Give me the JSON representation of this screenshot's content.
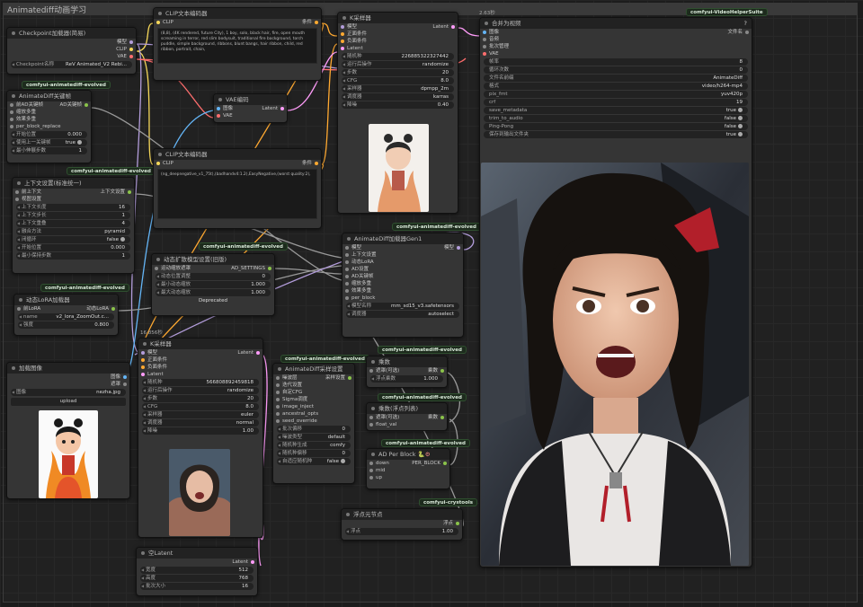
{
  "title": "Animatediff动画学习",
  "colors": {
    "clip": "#f6d85a",
    "model": "#b39ddb",
    "vae": "#ff6e6e",
    "cond": "#ffa931",
    "latent": "#ff9cf9",
    "image": "#64b5f6",
    "gen": "#8bc34a"
  },
  "badges": {
    "evolved": "comfyui-animatediff-evolved",
    "vhs": "comfyui-VideoHelperSuite",
    "crys": "comfyui-crystools"
  },
  "ckpt": {
    "title": "Checkpoint加载器(简易)",
    "o_model": "模型",
    "o_clip": "CLIP",
    "o_vae": "VAE",
    "w_label": "Checkpoint名称",
    "w_val": "ReV Animated_V2 Rebi..."
  },
  "clip1": {
    "title": "CLIP文本编码器",
    "i_clip": "CLIP",
    "o_cond": "条件",
    "text": "(8,8), (4K rendered, future City), 1 boy, solo, black hair, fire, open mouth screaming in terror, red slim bodysuit, traditional fire background, torch puddle, simple background, ribbons, blunt bangs, hair ribbon, child, red ribbon, portrait, chain,"
  },
  "clip2": {
    "title": "CLIP文本编码器",
    "i_clip": "CLIP",
    "o_cond": "条件",
    "text": "(ng_deepnegative_v1_75t),(badhandv4:1.2),EasyNegative,(worst quality:2),"
  },
  "vaeenc": {
    "title": "VAE编码",
    "i_img": "图像",
    "i_vae": "VAE",
    "o_lat": "Latent"
  },
  "ksampler1": {
    "title": "K采样器",
    "i_model": "模型",
    "i_pos": "正面条件",
    "i_neg": "负面条件",
    "i_lat": "Latent",
    "o_lat": "Latent",
    "rows": [
      [
        "随机种",
        "226885322327442"
      ],
      [
        "运行后操作",
        "randomize"
      ],
      [
        "步数",
        "20"
      ],
      [
        "CFG",
        "8.0"
      ],
      [
        "采样器",
        "dpmpp_2m"
      ],
      [
        "调度器",
        "karras"
      ],
      [
        "降噪",
        "0.40"
      ]
    ]
  },
  "ksampler2": {
    "label": "16.856秒",
    "title": "K采样器",
    "i_model": "模型",
    "i_pos": "正面条件",
    "i_neg": "负面条件",
    "i_lat": "Latent",
    "o_lat": "Latent",
    "rows": [
      [
        "随机种",
        "566808892459818"
      ],
      [
        "运行后操作",
        "randomize"
      ],
      [
        "步数",
        "20"
      ],
      [
        "CFG",
        "8.0"
      ],
      [
        "采样器",
        "euler"
      ],
      [
        "调度器",
        "normal"
      ],
      [
        "降噪",
        "1.00"
      ]
    ]
  },
  "adkeyframe": {
    "title": "AnimateDiff关键帧",
    "i_prev": "前AD关键帧",
    "o_kf": "AD关键帧",
    "i1": "缩放多重",
    "i2": "效果多重",
    "i3": "per_block_replace",
    "rows": [
      [
        "开始位置",
        "0.000"
      ],
      [
        "使用上一关键帧",
        "true"
      ],
      [
        "最小伸展步数",
        "1"
      ]
    ]
  },
  "context": {
    "title": "上下文设置(标准统一)",
    "i_prev": "前上下文",
    "o_ctx": "上下文设置",
    "i_view": "视图设置",
    "rows": [
      [
        "上下文长度",
        "16"
      ],
      [
        "上下文步长",
        "1"
      ],
      [
        "上下文重叠",
        "4"
      ],
      [
        "融合方法",
        "pyramid"
      ],
      [
        "闭循环",
        "false"
      ],
      [
        "开始位置",
        "0.000"
      ],
      [
        "最小保持步数",
        "1"
      ]
    ]
  },
  "lora": {
    "title": "动态LoRA加载器",
    "i_prev": "前LoRA",
    "o_lora": "动态LoRA",
    "w1": "name",
    "w1v": "v2_lora_ZoomOut.c...",
    "w2": "强度",
    "w2v": "0.800"
  },
  "loadimg": {
    "title": "加载图像",
    "o_img": "图像",
    "o_mask": "遮罩",
    "w_label": "图像",
    "w_val": "nezha.jpg",
    "upload": "upload"
  },
  "motion": {
    "title": "动态扩散模型设置(旧版)",
    "i1": "运动缩放遮罩",
    "o": "AD_SETTINGS",
    "rows": [
      [
        "动态位置调整",
        "0"
      ],
      [
        "最小动态缩放",
        "1.000"
      ],
      [
        "最大动态缩放",
        "1.000"
      ]
    ],
    "status": "Deprecated"
  },
  "adloader": {
    "title": "AnimateDiff加载器Gen1",
    "i": [
      "模型",
      "上下文设置",
      "动态LoRA",
      "AD设置",
      "AD关键帧",
      "缩放多重",
      "效果多重",
      "per_block"
    ],
    "o": "模型",
    "rows": [
      [
        "模型名称",
        "mm_sd15_v3.safetensors"
      ],
      [
        "调度器",
        "autoselect"
      ]
    ]
  },
  "adsampling": {
    "title": "AnimateDiff采样设置",
    "o": "采样设置",
    "i": [
      "噪波层",
      "迭代设置",
      "自定CFG",
      "Sigma调度",
      "image_inject",
      "ancestral_opts",
      "seed_override"
    ],
    "rows": [
      [
        "批次偏移",
        "0"
      ],
      [
        "噪波类型",
        "default"
      ],
      [
        "随机种生成",
        "comfy"
      ],
      [
        "随机种偏移",
        "0"
      ],
      [
        "自适应随机种",
        "false"
      ]
    ]
  },
  "mult1": {
    "title": "乘数",
    "i": "遮罩(可选)",
    "o": "乘数",
    "w": "浮点乘数",
    "wv": "1.000"
  },
  "mult2": {
    "title": "乘数(浮点列表)",
    "i1": "遮罩(可选)",
    "i2": "float_val",
    "o": "乘数"
  },
  "perblock": {
    "title": "AD Per Block",
    "o": "PER_BLOCK",
    "i": [
      "down",
      "mid",
      "up"
    ]
  },
  "floatnode": {
    "title": "浮点元节点",
    "o": "浮点",
    "w": "浮点",
    "wv": "1.00"
  },
  "emptylat": {
    "title": "空Latent",
    "o": "Latent",
    "rows": [
      [
        "宽度",
        "512"
      ],
      [
        "高度",
        "768"
      ],
      [
        "批次大小",
        "16"
      ]
    ]
  },
  "vhs": {
    "time": "2.63秒",
    "title": "合并为视频",
    "o": "文件名",
    "i": [
      "图像",
      "音频",
      "批次管理",
      "VAE"
    ],
    "rows": [
      [
        "帧率",
        "8"
      ],
      [
        "循环次数",
        "0"
      ],
      [
        "文件名前缀",
        "AnimateDiff"
      ],
      [
        "格式",
        "video/h264-mp4"
      ],
      [
        "pix_fmt",
        "yuv420p"
      ],
      [
        "crf",
        "19"
      ],
      [
        "save_metadata",
        "true"
      ],
      [
        "trim_to_audio",
        "false"
      ],
      [
        "Ping-Pong",
        "false"
      ],
      [
        "保存到输出文件夹",
        "true"
      ]
    ]
  }
}
